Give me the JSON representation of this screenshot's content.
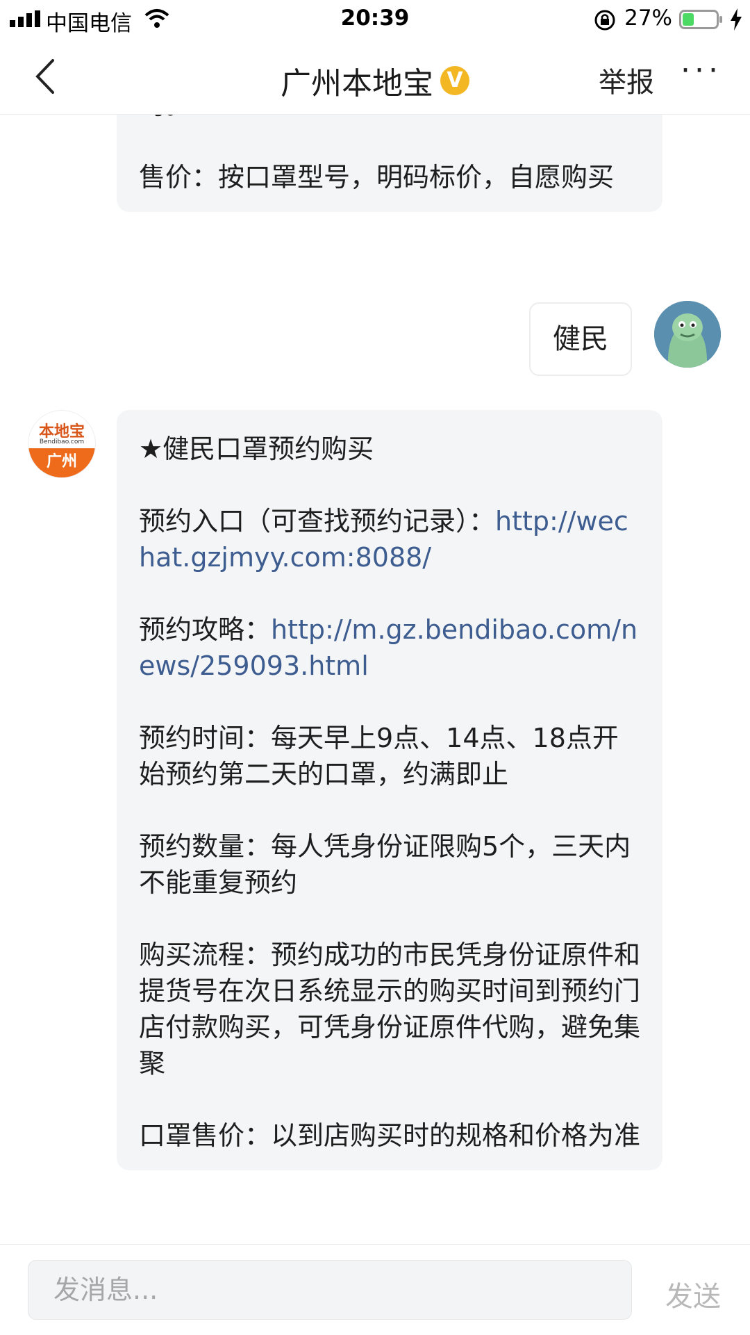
{
  "status_bar": {
    "carrier": "中国电信",
    "time": "20:39",
    "battery": "27%"
  },
  "nav": {
    "title": "广州本地宝",
    "verified_badge": "V",
    "report": "举报",
    "more": "···"
  },
  "messages": {
    "previous": {
      "paragraphs": [
        "约。",
        "售价：按口罩型号，明码标价，自愿购买"
      ]
    },
    "user_reply": "健民",
    "bot_reply": {
      "avatar_top": "本地宝",
      "avatar_mid": "Bendibao.com",
      "avatar_bottom": "广州",
      "heading": "★健民口罩预约购买",
      "entry_label": "预约入口（可查找预约记录）：",
      "entry_link": "http://wechat.gzjmyy.com:8088/",
      "guide_label": "预约攻略：",
      "guide_link": "http://m.gz.bendibao.com/news/259093.html",
      "time": "预约时间：每天早上9点、14点、18点开始预约第二天的口罩，约满即止",
      "quantity": "预约数量：每人凭身份证限购5个，三天内不能重复预约",
      "process": "购买流程：预约成功的市民凭身份证原件和提货号在次日系统显示的购买时间到预约门店付款购买，可凭身份证原件代购，避免集聚",
      "price": "口罩售价：以到店购买时的规格和价格为准"
    }
  },
  "composer": {
    "placeholder": "发消息...",
    "send": "发送"
  }
}
